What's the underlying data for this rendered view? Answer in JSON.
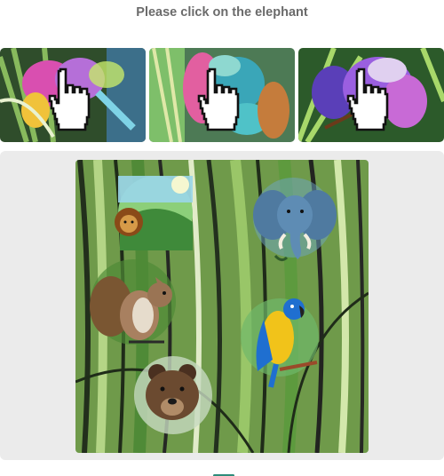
{
  "prompt": "Please click on the elephant",
  "examples": [
    {
      "name": "example-1",
      "icon": "pointer-hand-icon"
    },
    {
      "name": "example-2",
      "icon": "pointer-hand-icon"
    },
    {
      "name": "example-3",
      "icon": "pointer-hand-icon"
    }
  ],
  "puzzle": {
    "animals": [
      "lion",
      "elephant",
      "squirrel",
      "parrot",
      "bear"
    ],
    "background": "green bamboo stained-glass forest"
  },
  "colors": {
    "prompt": "#6b6b6b",
    "panel": "#ebebeb",
    "accent": "#2e8c7a"
  }
}
